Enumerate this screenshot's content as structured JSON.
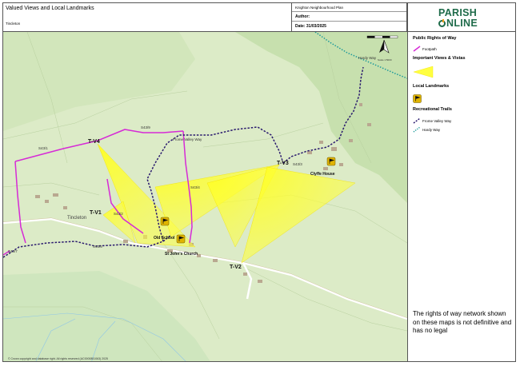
{
  "header": {
    "title": "Valued Views and Local Landmarks",
    "subtitle": "Tincleton",
    "plan": "Knighton Neighbourhood Plan",
    "author_label": "Author:",
    "date_label": "Date: 31/03/2025"
  },
  "logo": {
    "line1": "PARISH",
    "line2_rest": "NLINE"
  },
  "legend": {
    "prow_heading": "Public Rights of Way",
    "footpath": "Footpath",
    "views_heading": "Important Views & Vistas",
    "landmarks_heading": "Local Landmarks",
    "trails_heading": "Recreational Trails",
    "frome": "Frome Valley Way",
    "hardy": "Hardy Way"
  },
  "note": "The rights of way network shown on these maps is not definitive and has no legal",
  "map": {
    "copyright": "© Crown copyright and database right. All rights reserved (AC0000851063) 2025",
    "scale_label": "Scale 1:5000",
    "view_labels": [
      "T-V4",
      "T-V1",
      "T-V3",
      "T-V2"
    ],
    "landmark_labels": [
      "Old School",
      "St John's Church",
      "Clyffe House"
    ],
    "place_label": "Tincleton",
    "trail_labels": [
      "Frome Valley Way",
      "Hardy Way"
    ],
    "path_codes": [
      "S43/1",
      "S43/9",
      "S43/4",
      "S43/2",
      "S43/3",
      "S43/5",
      "S43/7"
    ]
  },
  "colors": {
    "footpath": "#d62ad6",
    "frome_valley_way": "#2a1a6e",
    "hardy_way": "#1c9a9a",
    "view_fill": "#ffff33",
    "landmark": "#e0b400",
    "map_base": "#dcebc7",
    "brand": "#1f6b4a"
  }
}
